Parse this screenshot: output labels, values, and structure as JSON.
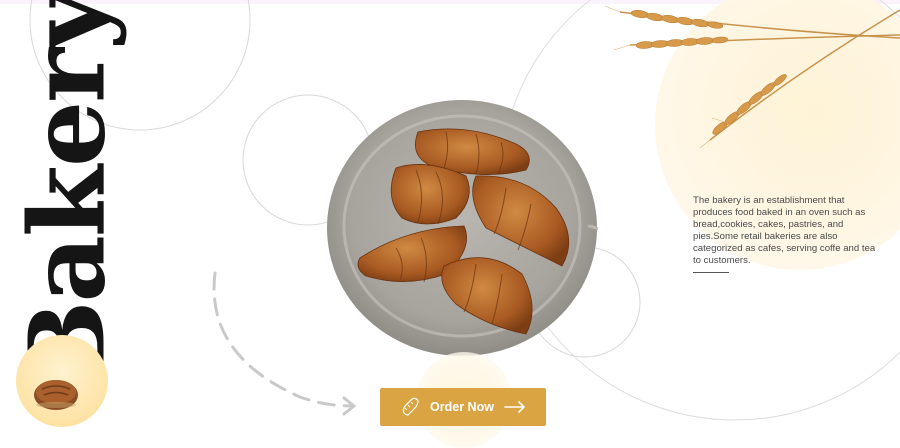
{
  "hero": {
    "title": "Bakery",
    "description": "The bakery is an establishment that produces food baked in an oven such as bread,cookies, cakes, pastries, and pies.Some retail bakeries are also categorized as cafes, serving coffe and tea to customers."
  },
  "cta": {
    "label": "Order Now"
  },
  "icons": [
    "bread-loaf-icon",
    "baguette-icon",
    "arrow-right-icon",
    "wheat-image",
    "croissant-basket-image"
  ],
  "colors": {
    "accent": "#d9a441",
    "title": "#151515",
    "blob": "#fef3d6"
  }
}
